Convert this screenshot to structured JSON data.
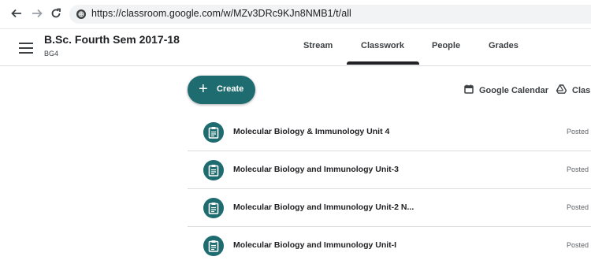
{
  "browser": {
    "url": "https://classroom.google.com/w/MZv3DRc9KJn8NMB1/t/all"
  },
  "header": {
    "class_title": "B.Sc. Fourth Sem 2017-18",
    "class_section": "BG4",
    "tabs": [
      {
        "label": "Stream",
        "selected": false
      },
      {
        "label": "Classwork",
        "selected": true
      },
      {
        "label": "People",
        "selected": false
      },
      {
        "label": "Grades",
        "selected": false
      }
    ]
  },
  "toolbar": {
    "create_label": "Create",
    "calendar_label": "Google Calendar",
    "drive_label": "Clas"
  },
  "materials": [
    {
      "title": "Molecular Biology & Immunology Unit 4",
      "status": "Posted"
    },
    {
      "title": "Molecular Biology and Immunology Unit-3",
      "status": "Posted I"
    },
    {
      "title": "Molecular Biology and Immunology Unit-2 N...",
      "status": "Posted I"
    },
    {
      "title": "Molecular Biology and Immunology Unit-I",
      "status": "Posted"
    }
  ],
  "colors": {
    "accent": "#1e6b70",
    "text": "#202124",
    "divider": "#dadce0"
  }
}
